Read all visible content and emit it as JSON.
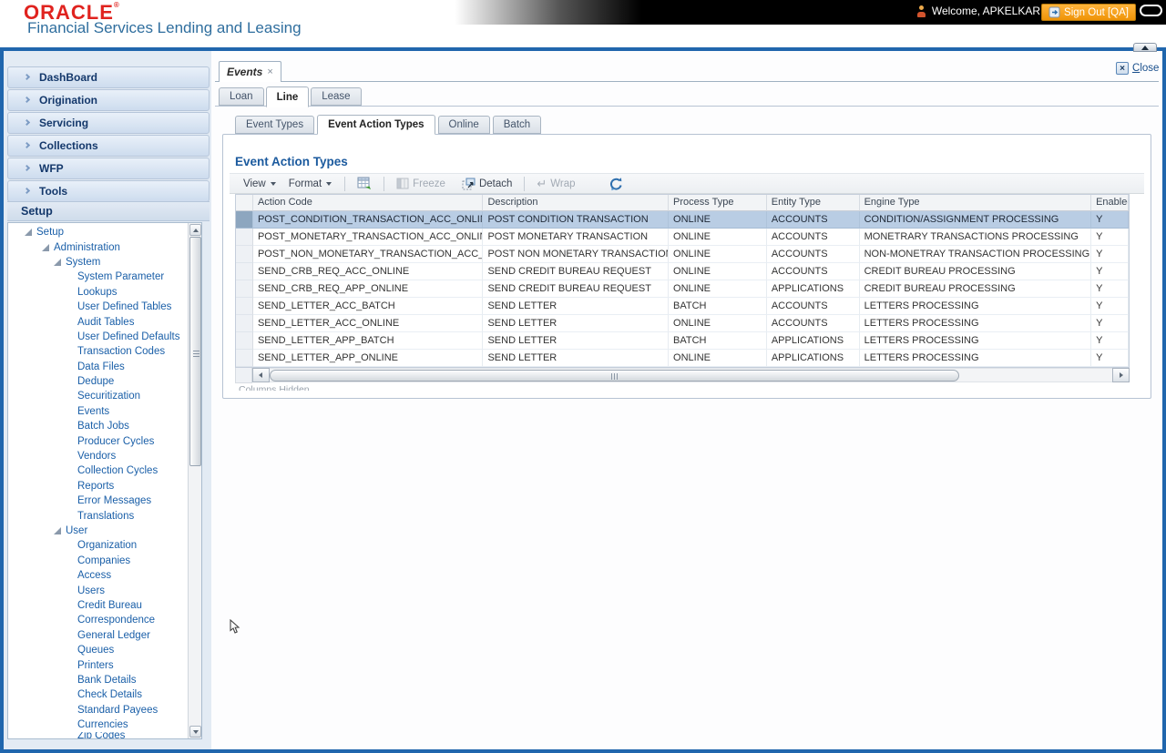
{
  "header": {
    "logo": "ORACLE",
    "logo_mark": "®",
    "subtitle": "Financial Services Lending and Leasing",
    "welcome": "Welcome, APKELKAR",
    "sign_out": "Sign Out [QA]"
  },
  "window": {
    "doc_tab": "Events",
    "doc_tab_close": "×",
    "close": "Close",
    "close_x": "×"
  },
  "sidebar": {
    "items": [
      "DashBoard",
      "Origination",
      "Servicing",
      "Collections",
      "WFP",
      "Tools"
    ],
    "setup": "Setup",
    "tree": [
      "Setup",
      "Administration",
      "System",
      "System Parameter",
      "Lookups",
      "User Defined Tables",
      "Audit Tables",
      "User Defined Defaults",
      "Transaction Codes",
      "Data Files",
      "Dedupe",
      "Securitization",
      "Events",
      "Batch Jobs",
      "Producer Cycles",
      "Vendors",
      "Collection Cycles",
      "Reports",
      "Error Messages",
      "Translations",
      "User",
      "Organization",
      "Companies",
      "Access",
      "Users",
      "Credit Bureau",
      "Correspondence",
      "General Ledger",
      "Queues",
      "Printers",
      "Bank Details",
      "Check Details",
      "Standard Payees",
      "Currencies"
    ],
    "tree_clipped": "Zip Codes"
  },
  "tabs": {
    "level2": [
      "Loan",
      "Line",
      "Lease"
    ],
    "level2_active": "Line",
    "level3": [
      "Event Types",
      "Event Action Types",
      "Online",
      "Batch"
    ],
    "level3_active": "Event Action Types"
  },
  "panel": {
    "title": "Event Action Types"
  },
  "toolbar": {
    "view": "View",
    "format": "Format",
    "freeze": "Freeze",
    "detach": "Detach",
    "wrap": "Wrap"
  },
  "table": {
    "columns": [
      "Action Code",
      "Description",
      "Process Type",
      "Entity Type",
      "Engine Type",
      "Enabled"
    ],
    "rows": [
      [
        "POST_CONDITION_TRANSACTION_ACC_ONLINE",
        "POST CONDITION TRANSACTION",
        "ONLINE",
        "ACCOUNTS",
        "CONDITION/ASSIGNMENT PROCESSING",
        "Y"
      ],
      [
        "POST_MONETARY_TRANSACTION_ACC_ONLINE",
        "POST MONETARY TRANSACTION",
        "ONLINE",
        "ACCOUNTS",
        "MONETRARY TRANSACTIONS PROCESSING",
        "Y"
      ],
      [
        "POST_NON_MONETARY_TRANSACTION_ACC_ON...",
        "POST NON MONETARY TRANSACTION",
        "ONLINE",
        "ACCOUNTS",
        "NON-MONETRAY TRANSACTION PROCESSING",
        "Y"
      ],
      [
        "SEND_CRB_REQ_ACC_ONLINE",
        "SEND CREDIT BUREAU REQUEST",
        "ONLINE",
        "ACCOUNTS",
        "CREDIT BUREAU PROCESSING",
        "Y"
      ],
      [
        "SEND_CRB_REQ_APP_ONLINE",
        "SEND CREDIT BUREAU REQUEST",
        "ONLINE",
        "APPLICATIONS",
        "CREDIT BUREAU PROCESSING",
        "Y"
      ],
      [
        "SEND_LETTER_ACC_BATCH",
        "SEND LETTER",
        "BATCH",
        "ACCOUNTS",
        "LETTERS PROCESSING",
        "Y"
      ],
      [
        "SEND_LETTER_ACC_ONLINE",
        "SEND LETTER",
        "ONLINE",
        "ACCOUNTS",
        "LETTERS PROCESSING",
        "Y"
      ],
      [
        "SEND_LETTER_APP_BATCH",
        "SEND LETTER",
        "BATCH",
        "APPLICATIONS",
        "LETTERS PROCESSING",
        "Y"
      ],
      [
        "SEND_LETTER_APP_ONLINE",
        "SEND LETTER",
        "ONLINE",
        "APPLICATIONS",
        "LETTERS PROCESSING",
        "Y"
      ]
    ],
    "selected_row_index": 0,
    "clipped_footer": "Columns Hidden"
  },
  "colors": {
    "oracle_red": "#e0231f",
    "subtitle_blue": "#2f6e9e",
    "frame_blue": "#2066ad",
    "signout_orange": "#f49b15",
    "sidebar_text": "#14386b",
    "tree_text": "#1a5fa8",
    "heading_blue": "#1b5a9e",
    "selected_row_bg": "#b9cde4",
    "table_header_bg": "#f2f4f6"
  }
}
